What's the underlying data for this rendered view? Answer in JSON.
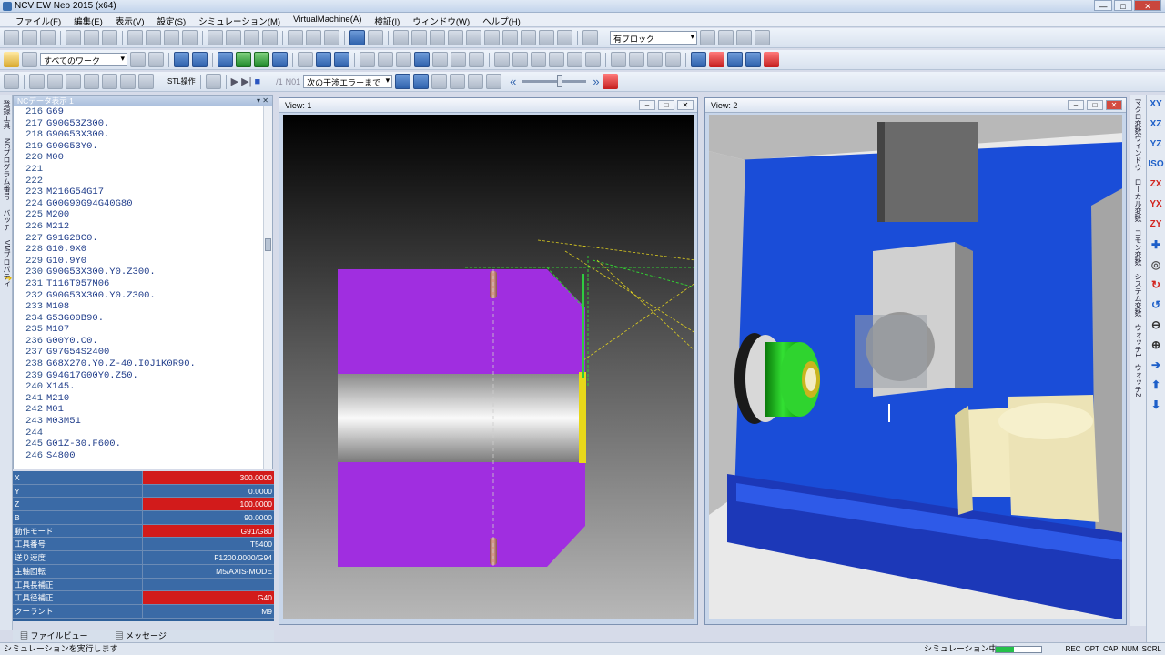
{
  "window": {
    "title": "NCVIEW Neo 2015 (x64)"
  },
  "menu": [
    "ファイル(F)",
    "編集(E)",
    "表示(V)",
    "設定(S)",
    "シミュレーション(M)",
    "VirtualMachine(A)",
    "検証(I)",
    "ウィンドウ(W)",
    "ヘルプ(H)"
  ],
  "toolbar": {
    "block_combo": "有ブロック",
    "work_combo": "すべてのワーク",
    "stl_label": "STL操作",
    "n01_label": "N01",
    "interference_combo": "次の干渉エラーまで"
  },
  "nc_panel": {
    "title": "NCデータ表示 1",
    "lines": [
      {
        "no": "216",
        "code": "G69"
      },
      {
        "no": "217",
        "code": "G90G53Z300."
      },
      {
        "no": "218",
        "code": "G90G53X300."
      },
      {
        "no": "219",
        "code": "G90G53Y0."
      },
      {
        "no": "220",
        "code": "M00"
      },
      {
        "no": "221",
        "code": ""
      },
      {
        "no": "222",
        "code": ""
      },
      {
        "no": "223",
        "code": "M216G54G17"
      },
      {
        "no": "224",
        "code": "G00G90G94G40G80"
      },
      {
        "no": "225",
        "code": "M200"
      },
      {
        "no": "226",
        "code": "M212"
      },
      {
        "no": "227",
        "code": "G91G28C0."
      },
      {
        "no": "228",
        "code": "G10.9X0"
      },
      {
        "no": "229",
        "code": "G10.9Y0"
      },
      {
        "no": "230",
        "code": "G90G53X300.Y0.Z300."
      },
      {
        "no": "231",
        "code": "T116T057M06"
      },
      {
        "no": "232",
        "code": "G90G53X300.Y0.Z300."
      },
      {
        "no": "233",
        "code": "M108"
      },
      {
        "no": "234",
        "code": "G53G00B90."
      },
      {
        "no": "235",
        "code": "M107"
      },
      {
        "no": "236",
        "code": "G00Y0.C0."
      },
      {
        "no": "237",
        "code": "G97G54S2400"
      },
      {
        "no": "238",
        "code": "G68X270.Y0.Z-40.I0J1K0R90."
      },
      {
        "no": "239",
        "code": "G94G17G00Y0.Z50."
      },
      {
        "no": "240",
        "code": "X145."
      },
      {
        "no": "241",
        "code": "M210"
      },
      {
        "no": "242",
        "code": "M01"
      },
      {
        "no": "243",
        "code": "M03M51"
      },
      {
        "no": "244",
        "code": ""
      },
      {
        "no": "245",
        "code": "G01Z-30.F600."
      },
      {
        "no": "246",
        "code": "S4800"
      }
    ]
  },
  "status": [
    {
      "key": "X",
      "value": "300.0000",
      "alert": true
    },
    {
      "key": "Y",
      "value": "0.0000",
      "alert": false
    },
    {
      "key": "Z",
      "value": "100.0000",
      "alert": true
    },
    {
      "key": "B",
      "value": "90.0000",
      "alert": false
    },
    {
      "key": "動作モード",
      "value": "G91/G80",
      "alert": true
    },
    {
      "key": "工具番号",
      "value": "T5400",
      "alert": false
    },
    {
      "key": "送り速度",
      "value": "F1200.0000/G94",
      "alert": false
    },
    {
      "key": "主軸回転",
      "value": "M5/AXIS-MODE",
      "alert": false
    },
    {
      "key": "工具長補正",
      "value": "",
      "alert": false
    },
    {
      "key": "工具径補正",
      "value": "G40",
      "alert": true
    },
    {
      "key": "クーラント",
      "value": "M9",
      "alert": false
    }
  ],
  "bottom_tabs": [
    "ファイルビュー",
    "メッセージ"
  ],
  "left_tabs": [
    "登録工具",
    "NCプログラム番号",
    "バッチ",
    "VMプロパティ"
  ],
  "right_tabs": [
    "マクロ変数ウインドウ",
    "ローカル変数",
    "コモン変数",
    "システム変数",
    "ウォッチ1",
    "ウォッチ2"
  ],
  "views": [
    {
      "title": "View: 1"
    },
    {
      "title": "View: 2"
    }
  ],
  "view_buttons": [
    "XY",
    "XZ",
    "YZ",
    "ISO",
    "ZX",
    "YX",
    "ZY"
  ],
  "statusbar": {
    "message": "シミュレーションを実行します",
    "sim": "シミュレーション中",
    "progress": 0.4,
    "keys": [
      "REC",
      "OPT",
      "CAP",
      "NUM",
      "SCRL"
    ]
  },
  "colors": {
    "part": "#a02ee0",
    "machine_blue": "#1a4dd8",
    "alert": "#d21b1b"
  }
}
